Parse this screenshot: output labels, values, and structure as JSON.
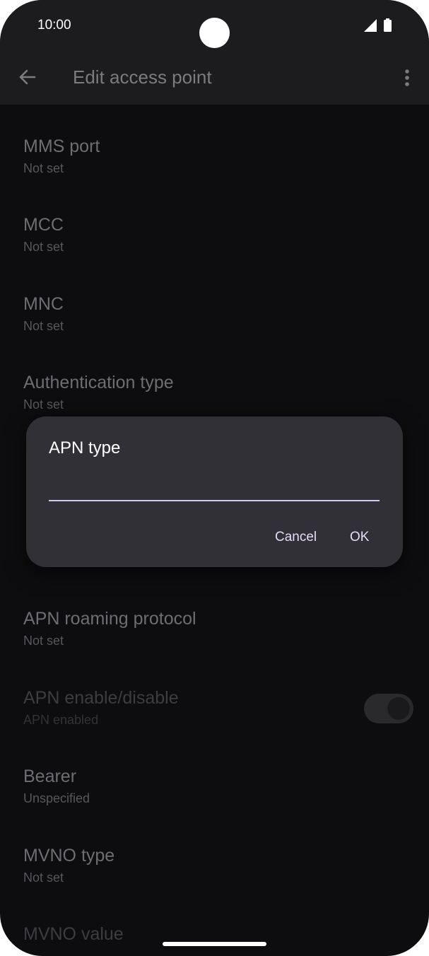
{
  "status_bar": {
    "time": "10:00"
  },
  "app_bar": {
    "title": "Edit access point"
  },
  "settings": [
    {
      "title": "MMS port",
      "summary": "Not set"
    },
    {
      "title": "MCC",
      "summary": "Not set"
    },
    {
      "title": "MNC",
      "summary": "Not set"
    },
    {
      "title": "Authentication type",
      "summary": "Not set"
    },
    {
      "title": "APN roaming protocol",
      "summary": "Not set"
    },
    {
      "title": "APN enable/disable",
      "summary": "APN enabled"
    },
    {
      "title": "Bearer",
      "summary": "Unspecified"
    },
    {
      "title": "MVNO type",
      "summary": "Not set"
    },
    {
      "title": "MVNO value",
      "summary": ""
    }
  ],
  "dialog": {
    "title": "APN type",
    "input_value": "",
    "cancel_label": "Cancel",
    "ok_label": "OK"
  },
  "colors": {
    "background": "#0d0d0f",
    "bar": "#1c1c1e",
    "dialog": "#313036",
    "accent": "#d4c8f0"
  },
  "icons": [
    "back-arrow-icon",
    "more-vert-icon",
    "signal-icon",
    "battery-icon"
  ]
}
